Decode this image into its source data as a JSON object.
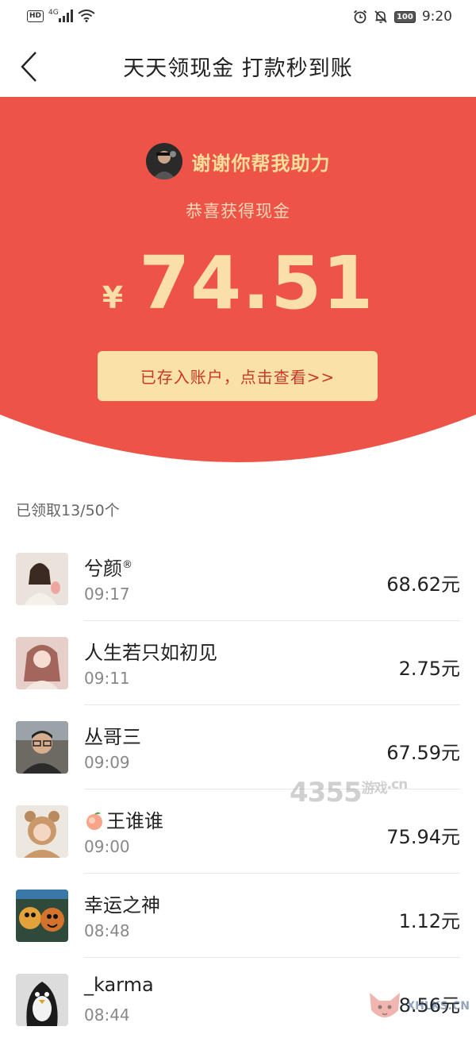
{
  "status_bar": {
    "hd_label": "HD",
    "network_label": "4G",
    "battery": "100",
    "time": "9:20"
  },
  "header": {
    "title": "天天领现金 打款秒到账"
  },
  "hero": {
    "sender_message": "谢谢你帮我助力",
    "subtitle": "恭喜获得现金",
    "currency_symbol": "¥",
    "amount": "74.51",
    "button_label": "已存入账户，点击查看>>",
    "colors": {
      "background": "#ee5348",
      "gold": "#fae0a8",
      "button_text": "#c8372a"
    }
  },
  "claimed_summary": "已领取13/50个",
  "claims": [
    {
      "name": "兮颜",
      "badge": "®",
      "time": "09:17",
      "amount": "68.62元"
    },
    {
      "name": "人生若只如初见",
      "time": "09:11",
      "amount": "2.75元"
    },
    {
      "name": "丛哥三",
      "time": "09:09",
      "amount": "67.59元"
    },
    {
      "name": "王谁谁",
      "prefix_icon": "peach-icon",
      "time": "09:00",
      "amount": "75.94元"
    },
    {
      "name": "幸运之神",
      "time": "08:48",
      "amount": "1.12元"
    },
    {
      "name": "_karma",
      "time": "08:44",
      "amount": "8.56元"
    }
  ],
  "watermarks": {
    "mid": "4355",
    "mid_suffix": "游戏",
    "mid_domain": ".cn",
    "corner": "XHLKS.CN"
  }
}
